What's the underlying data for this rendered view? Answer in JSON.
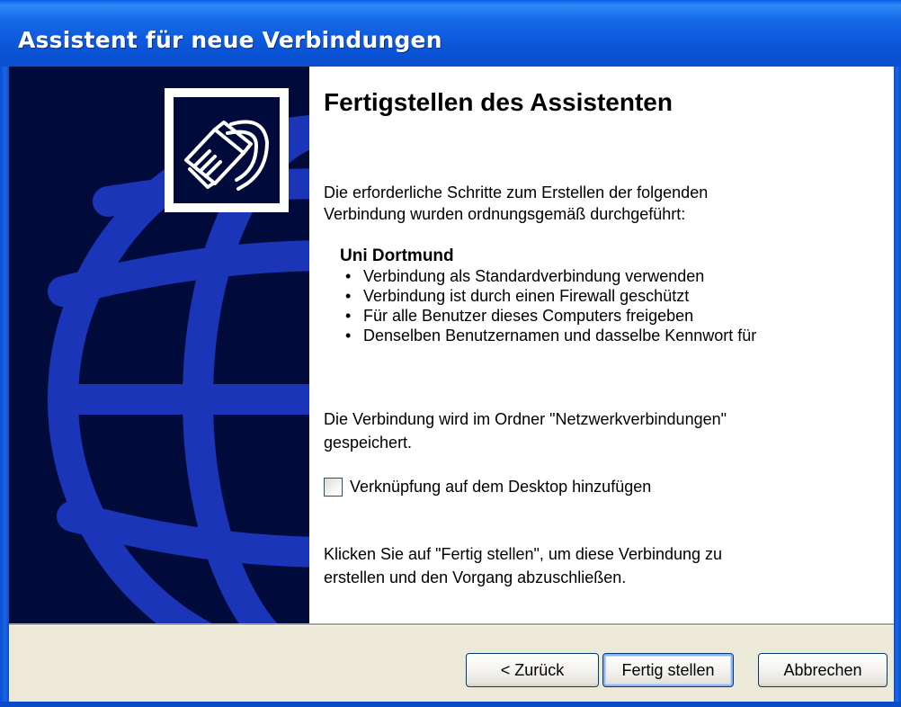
{
  "window": {
    "title": "Assistent für neue Verbindungen"
  },
  "sidebar": {
    "icon": "network-cable-icon",
    "background_color": "#000a3b",
    "globe_color": "#1a35b8"
  },
  "content": {
    "heading": "Fertigstellen des Assistenten",
    "intro_line1": "Die erforderliche Schritte zum Erstellen der folgenden",
    "intro_line2": "Verbindung wurden ordnungsgemäß durchgeführt:",
    "connection_name": "Uni Dortmund",
    "bullets": [
      "Verbindung als Standardverbindung verwenden",
      "Verbindung ist durch einen Firewall geschützt",
      "Für alle Benutzer dieses Computers freigeben",
      "Denselben Benutzernamen und dasselbe Kennwort für"
    ],
    "saved_line1": "Die Verbindung wird im Ordner \"Netzwerkverbindungen\"",
    "saved_line2": "gespeichert.",
    "checkbox_label": "Verknüpfung auf dem Desktop hinzufügen",
    "checkbox_checked": false,
    "finish_line1": "Klicken Sie auf \"Fertig stellen\", um diese Verbindung zu",
    "finish_line2": "erstellen und den Vorgang abzuschließen."
  },
  "buttons": {
    "back": "< Zurück",
    "finish": "Fertig stellen",
    "cancel": "Abbrechen"
  }
}
